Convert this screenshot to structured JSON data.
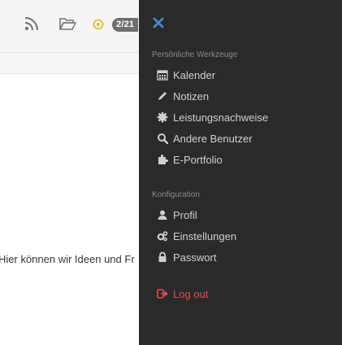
{
  "toolbar": {
    "badge": "2/21"
  },
  "content": {
    "text": "Hier können wir Ideen und Fr"
  },
  "sidebar": {
    "section_personal": "Persönliche Werkzeuge",
    "personal_items": [
      {
        "label": "Kalender",
        "icon": "calendar-icon"
      },
      {
        "label": "Notizen",
        "icon": "pencil-icon"
      },
      {
        "label": "Leistungsnachweise",
        "icon": "badge-icon"
      },
      {
        "label": "Andere Benutzer",
        "icon": "search-icon"
      },
      {
        "label": "E-Portfolio",
        "icon": "puzzle-icon"
      }
    ],
    "section_config": "Konfiguration",
    "config_items": [
      {
        "label": "Profil",
        "icon": "user-icon"
      },
      {
        "label": "Einstellungen",
        "icon": "gears-icon"
      },
      {
        "label": "Passwort",
        "icon": "lock-icon"
      }
    ],
    "logout": {
      "label": "Log out",
      "icon": "sign-out-icon"
    }
  },
  "colors": {
    "sidebar_bg": "#2a2a2a",
    "close_accent": "#4a86c7",
    "logout_red": "#e05050"
  }
}
